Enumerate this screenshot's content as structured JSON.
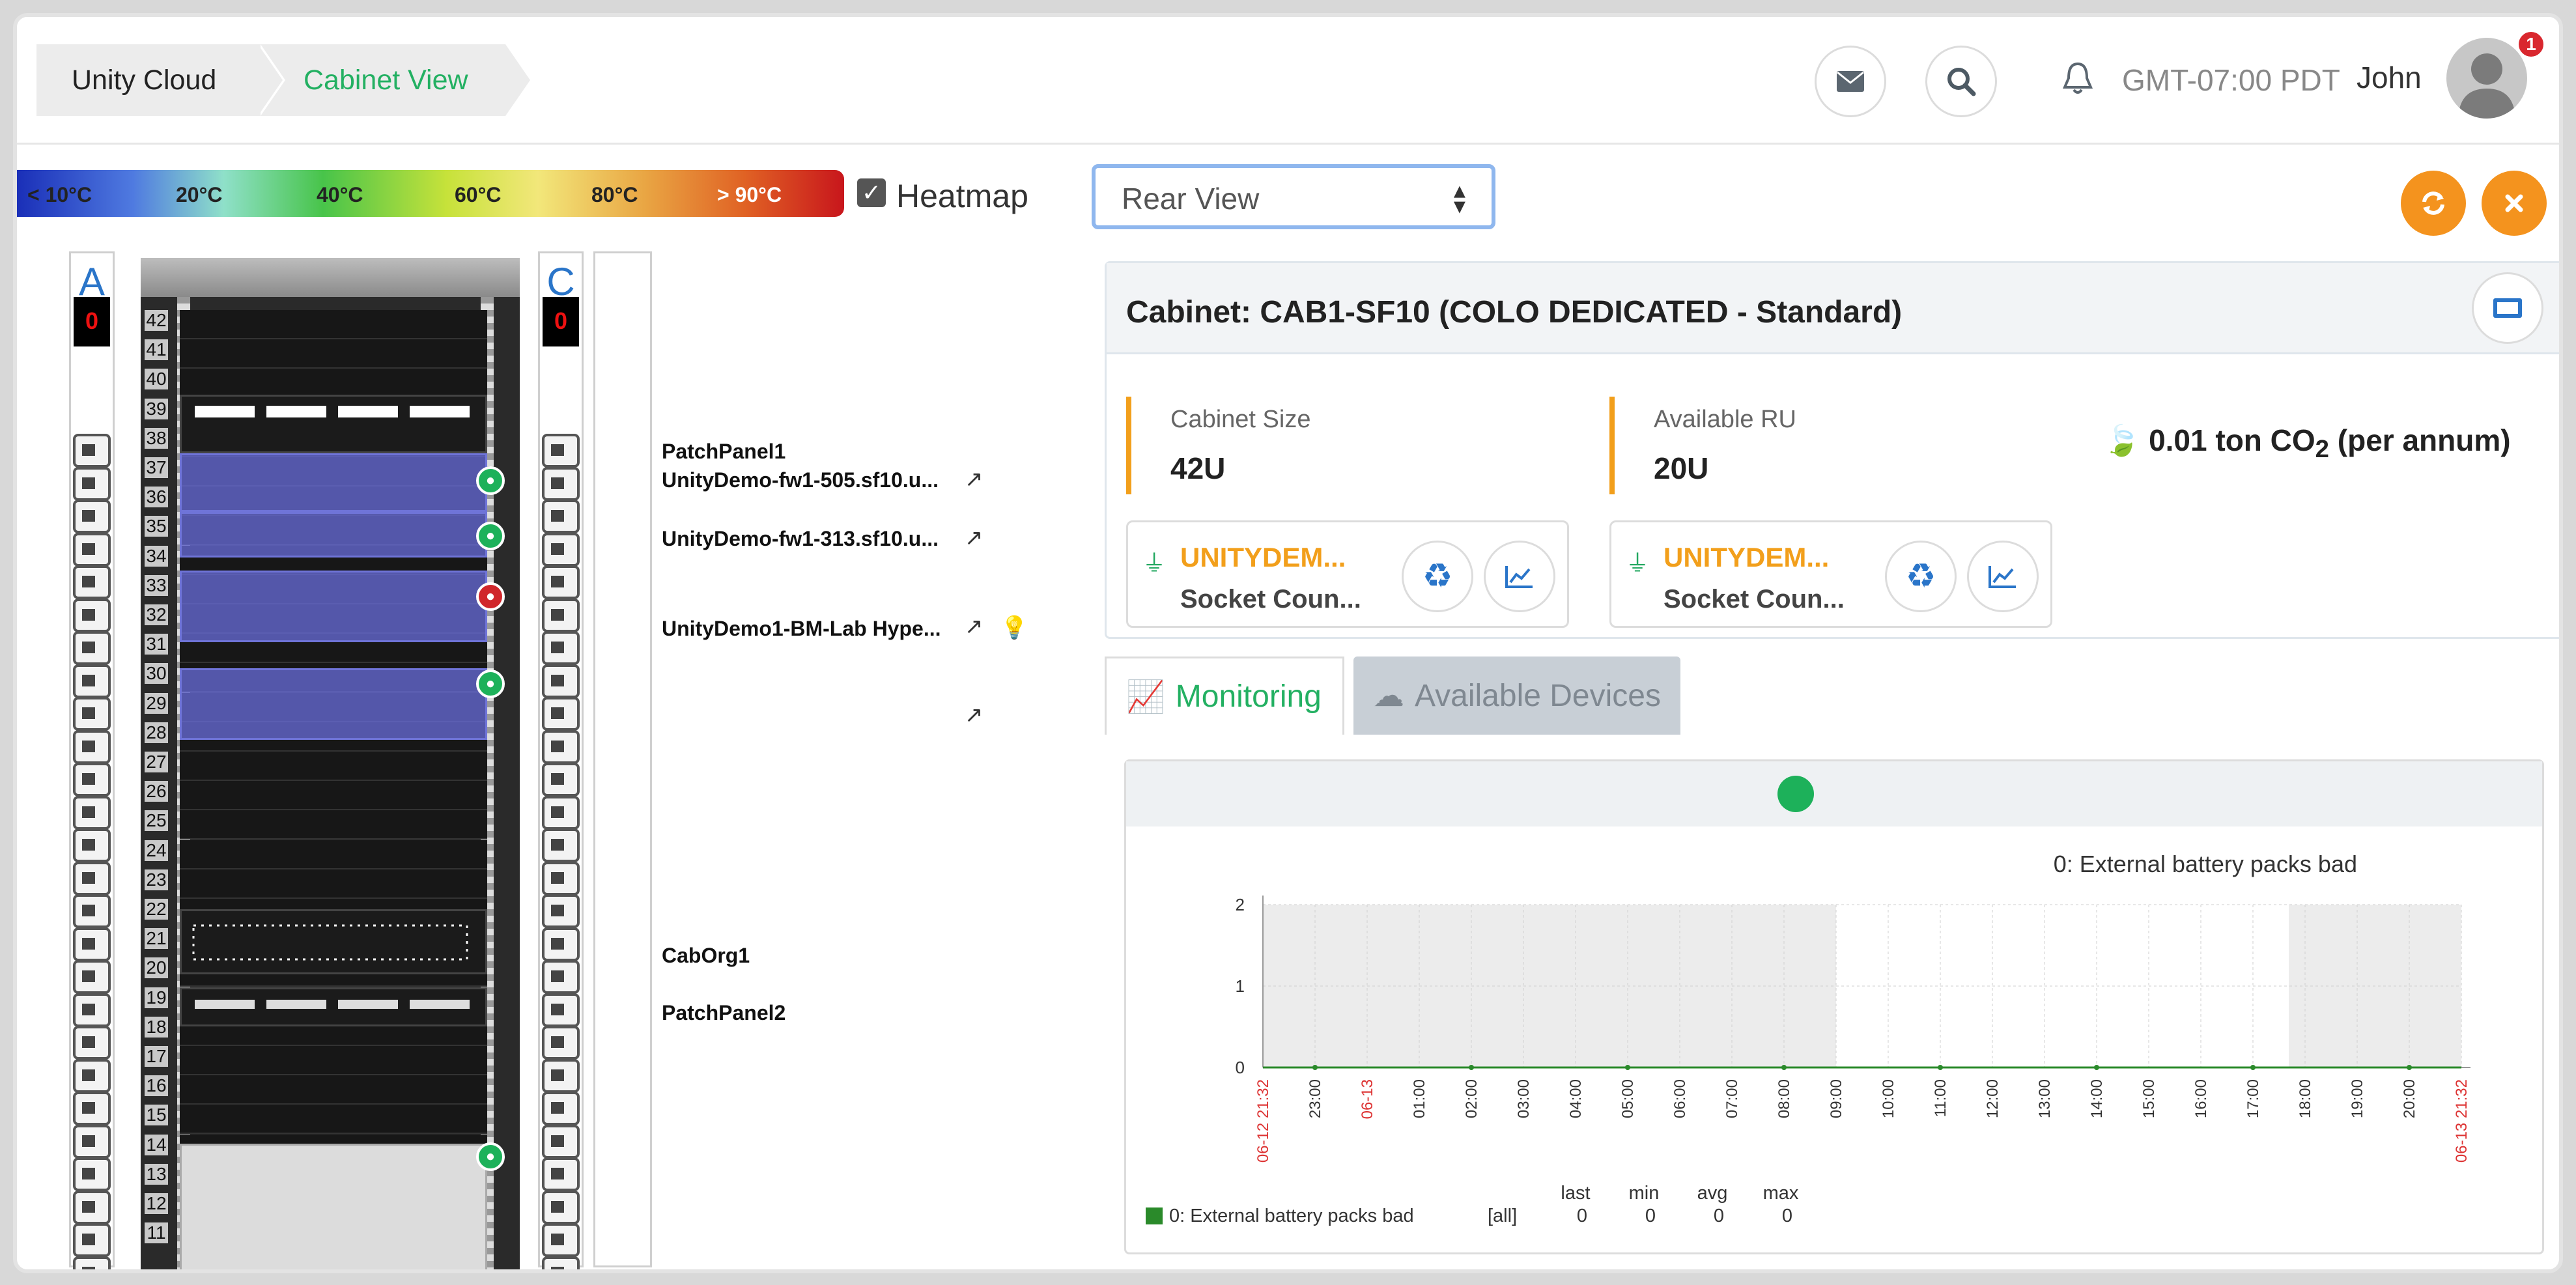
{
  "breadcrumb": {
    "items": [
      "Unity Cloud",
      "Cabinet View"
    ]
  },
  "header": {
    "timezone": "GMT-07:00 PDT",
    "user": "John",
    "notification_count": "1",
    "icons": [
      "envelope-icon",
      "search-icon",
      "bell-icon",
      "avatar"
    ]
  },
  "heatmap": {
    "scale": [
      "< 10°C",
      "20°C",
      "40°C",
      "60°C",
      "80°C",
      "> 90°C"
    ],
    "checkbox_label": "Heatmap",
    "checked": true
  },
  "view_select": {
    "value": "Rear View"
  },
  "rack": {
    "pdu_left": {
      "letter": "A",
      "count": "0"
    },
    "pdu_right": {
      "letter": "C",
      "count": "0"
    },
    "units": [
      42,
      41,
      40,
      39,
      38,
      37,
      36,
      35,
      34,
      33,
      32,
      31,
      30,
      29,
      28,
      27,
      26,
      25,
      24,
      23,
      22,
      21,
      20,
      19,
      18,
      17,
      16,
      15,
      14,
      13,
      12,
      11
    ],
    "devices": [
      {
        "name": "PatchPanel1",
        "status": "none"
      },
      {
        "name": "UnityDemo-fw1-505.sf10.u...",
        "status": "ok"
      },
      {
        "name": "UnityDemo-fw1-313.sf10.u...",
        "status": "ok"
      },
      {
        "name": "UnityDemo1-BM-Lab Hype...",
        "status": "error"
      },
      {
        "name": "",
        "status": "ok"
      },
      {
        "name": "CabOrg1",
        "status": "none"
      },
      {
        "name": "PatchPanel2",
        "status": "none"
      }
    ]
  },
  "cabinet": {
    "title": "Cabinet: CAB1-SF10 (COLO DEDICATED - Standard)",
    "size_label": "Cabinet Size",
    "size_value": "42U",
    "ru_label": "Available RU",
    "ru_value": "20U",
    "co2": "0.01 ton CO",
    "co2_sub": "2",
    "co2_suffix": " (per annum)",
    "power": [
      {
        "name": "UNITYDEM...",
        "sub": "Socket Coun..."
      },
      {
        "name": "UNITYDEM...",
        "sub": "Socket Coun..."
      }
    ]
  },
  "tabs": {
    "monitoring": "Monitoring",
    "available": "Available Devices"
  },
  "chart_data": {
    "type": "line",
    "title": "0: External battery packs bad",
    "ylim": [
      0,
      2
    ],
    "yticks": [
      "2",
      "1",
      "0"
    ],
    "x": [
      "06-12 21:32",
      "23:00",
      "06-13",
      "01:00",
      "02:00",
      "03:00",
      "04:00",
      "05:00",
      "06:00",
      "07:00",
      "08:00",
      "09:00",
      "10:00",
      "11:00",
      "12:00",
      "13:00",
      "14:00",
      "15:00",
      "16:00",
      "17:00",
      "18:00",
      "19:00",
      "20:00",
      "06-13 21:32"
    ],
    "red_ticks": [
      "06-12 21:32",
      "06-13",
      "06-13 21:32"
    ],
    "series": [
      {
        "name": "0: External battery packs bad",
        "color": "#2a8a2a",
        "values": [
          0,
          0,
          0,
          0,
          0,
          0,
          0,
          0,
          0,
          0,
          0,
          0,
          0,
          0,
          0,
          0,
          0,
          0,
          0,
          0,
          0,
          0,
          0,
          0
        ]
      }
    ],
    "legend": {
      "entry": "0: External battery packs bad",
      "scope": "[all]",
      "headers": [
        "last",
        "min",
        "avg",
        "max"
      ],
      "values": [
        "0",
        "0",
        "0",
        "0"
      ]
    },
    "grid": true
  }
}
